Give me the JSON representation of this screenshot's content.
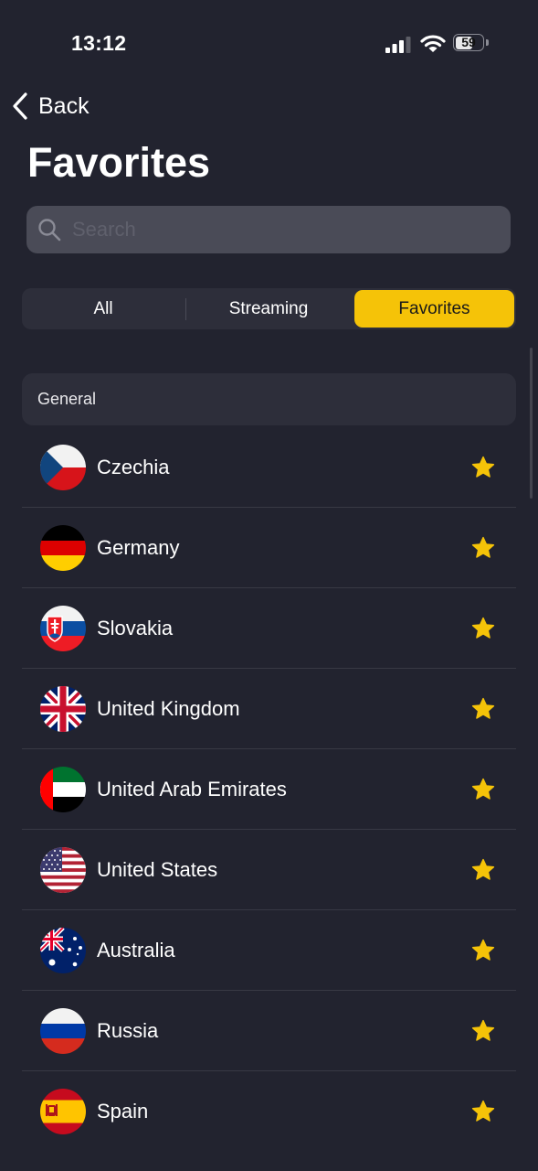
{
  "status_bar": {
    "time": "13:12",
    "battery": "59",
    "battery_level": 0.59
  },
  "nav": {
    "back_label": "Back"
  },
  "page_title": "Favorites",
  "search": {
    "placeholder": "Search",
    "value": ""
  },
  "tabs": [
    {
      "label": "All",
      "selected": false
    },
    {
      "label": "Streaming",
      "selected": false
    },
    {
      "label": "Favorites",
      "selected": true
    }
  ],
  "colors": {
    "accent": "#f5c308",
    "background": "#22232f",
    "card": "#2d2e3a"
  },
  "section": {
    "title": "General"
  },
  "countries": [
    {
      "name": "Czechia",
      "flag": "flag-czechia",
      "favorite": true
    },
    {
      "name": "Germany",
      "flag": "flag-germany",
      "favorite": true
    },
    {
      "name": "Slovakia",
      "flag": "flag-slovakia",
      "favorite": true
    },
    {
      "name": "United Kingdom",
      "flag": "flag-united-kingdom",
      "favorite": true
    },
    {
      "name": "United Arab Emirates",
      "flag": "flag-uae",
      "favorite": true
    },
    {
      "name": "United States",
      "flag": "flag-united-states",
      "favorite": true
    },
    {
      "name": "Australia",
      "flag": "flag-australia",
      "favorite": true
    },
    {
      "name": "Russia",
      "flag": "flag-russia",
      "favorite": true
    },
    {
      "name": "Spain",
      "flag": "flag-spain",
      "favorite": true
    }
  ]
}
